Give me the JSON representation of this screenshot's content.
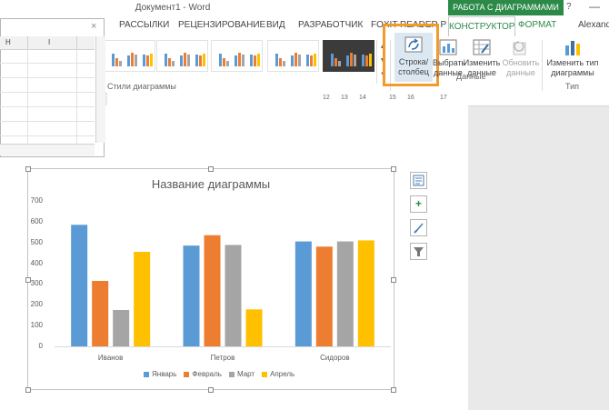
{
  "window": {
    "title": "Документ1 - Word",
    "context_group": "РАБОТА С ДИАГРАММАМИ",
    "help": "?",
    "minimize": "—"
  },
  "tabs": [
    "РАССЫЛКИ",
    "РЕЦЕНЗИРОВАНИЕ",
    "ВИД",
    "РАЗРАБОТЧИК",
    "FOXIT READER PDF"
  ],
  "context_tabs": {
    "constructor": "КОНСТРУКТОР",
    "format": "ФОРМАТ"
  },
  "user": "Alexande",
  "ribbon": {
    "styles_label": "Стили диаграммы",
    "switch_row_col": "Строка/ столбец",
    "select_data": "Выбрать данные",
    "edit_data": "Изменить данные",
    "refresh_data": "Обновить данные",
    "data_group": "Данные",
    "change_type": "Изменить тип диаграммы",
    "type_group": "Тип"
  },
  "ruler": {
    "numbers": [
      "12",
      "13",
      "14",
      "15",
      "16",
      "17"
    ]
  },
  "sheet": {
    "col_h": "H",
    "col_i": "I",
    "close": "×"
  },
  "chart_data": {
    "type": "bar",
    "title": "Название диаграммы",
    "categories": [
      "Иванов",
      "Петров",
      "Сидоров"
    ],
    "series": [
      {
        "name": "Январь",
        "values": [
          585,
          485,
          505
        ]
      },
      {
        "name": "Февраль",
        "values": [
          315,
          535,
          480
        ]
      },
      {
        "name": "Март",
        "values": [
          175,
          488,
          505
        ]
      },
      {
        "name": "Апрель",
        "values": [
          455,
          178,
          510
        ]
      }
    ],
    "ylim": [
      0,
      700
    ],
    "yticks": [
      "0",
      "100",
      "200",
      "300",
      "400",
      "500",
      "600",
      "700"
    ],
    "colors": [
      "#5b9bd5",
      "#ed7d31",
      "#a5a5a5",
      "#ffc000"
    ],
    "grid": false,
    "legend": "bottom"
  }
}
